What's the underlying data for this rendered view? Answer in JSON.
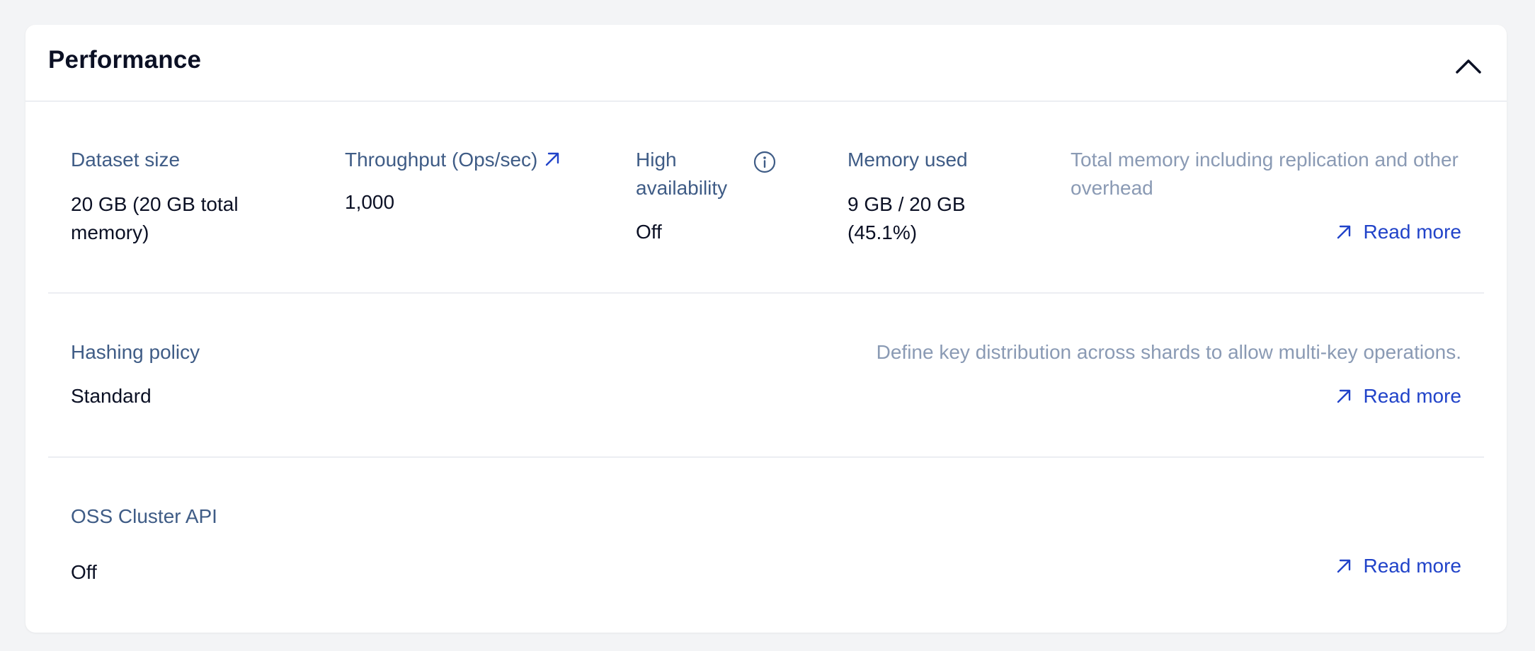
{
  "section": {
    "title": "Performance"
  },
  "row1": {
    "dataset_size": {
      "label": "Dataset size",
      "value": "20 GB (20 GB total memory)"
    },
    "throughput": {
      "label": "Throughput (Ops/sec)",
      "value": "1,000"
    },
    "high_availability": {
      "label": "High availability",
      "value": "Off"
    },
    "memory_used": {
      "label": "Memory used",
      "value": "9 GB / 20 GB (45.1%)",
      "description": "Total memory including replication and other overhead",
      "read_more": "Read more"
    }
  },
  "row2": {
    "hashing_policy": {
      "label": "Hashing policy",
      "value": "Standard",
      "description": "Define key distribution across shards to allow multi-key operations.",
      "read_more": "Read more"
    }
  },
  "row3": {
    "oss_cluster_api": {
      "label": "OSS Cluster API",
      "value": "Off",
      "read_more": "Read more"
    }
  },
  "icons": {
    "collapse": "chevron-up-icon",
    "external": "arrow-up-right-icon",
    "info": "info-icon"
  },
  "colors": {
    "label": "#3f5c86",
    "value": "#0b1024",
    "description": "#8a9ab4",
    "link": "#2143c9",
    "divider": "#eceef2",
    "page_bg": "#f3f4f6"
  }
}
